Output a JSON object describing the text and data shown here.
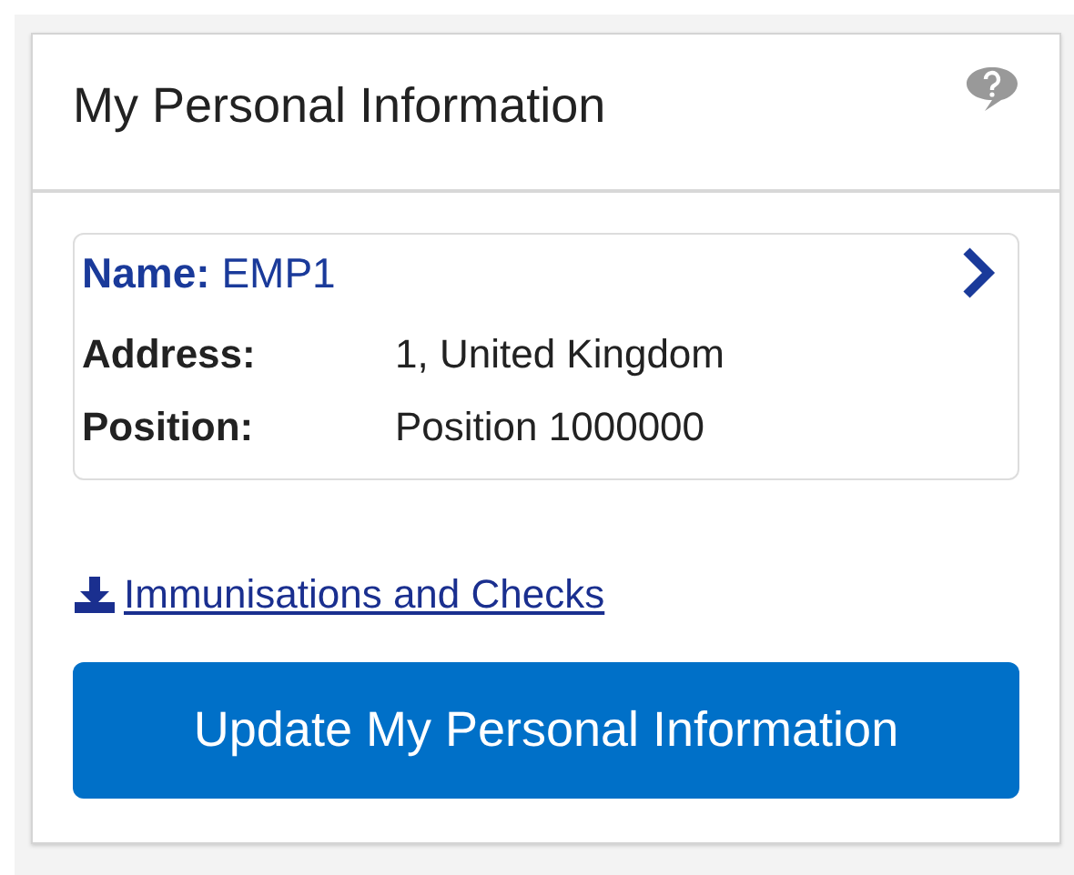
{
  "panel": {
    "title": "My Personal Information"
  },
  "employee": {
    "name_label": "Name:",
    "name": "EMP1",
    "details": [
      {
        "label": "Address:",
        "value": "1, United Kingdom"
      },
      {
        "label": "Position:",
        "value": "Position 1000000"
      }
    ]
  },
  "link": {
    "label": "Immunisations and Checks"
  },
  "button": {
    "label": "Update My Personal Information"
  }
}
